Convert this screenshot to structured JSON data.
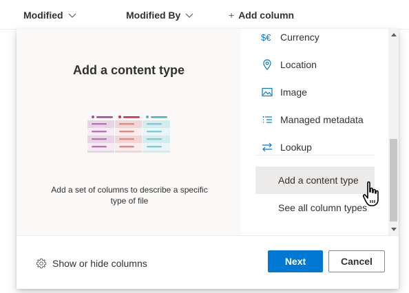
{
  "column_headers": {
    "modified": "Modified",
    "modified_by": "Modified By",
    "add_column": "Add column"
  },
  "preview": {
    "title": "Add a content type",
    "description": "Add a set of columns to describe a specific type of file"
  },
  "column_types": [
    {
      "label": "Currency",
      "icon": "currency-icon"
    },
    {
      "label": "Location",
      "icon": "location-pin-icon"
    },
    {
      "label": "Image",
      "icon": "image-icon"
    },
    {
      "label": "Managed metadata",
      "icon": "managed-metadata-icon"
    },
    {
      "label": "Lookup",
      "icon": "lookup-arrows-icon"
    }
  ],
  "add_content_type_label": "Add a content type",
  "see_all_label": "See all column types",
  "footer": {
    "show_hide_label": "Show or hide columns",
    "next_label": "Next",
    "cancel_label": "Cancel"
  },
  "colors": {
    "accent": "#0078d4",
    "selected_bg": "#edebe9",
    "preview_bg": "#faf9f8",
    "illustration_purple": "#9b4f96",
    "illustration_red": "#c4314b",
    "illustration_teal": "#4fb3bf"
  }
}
